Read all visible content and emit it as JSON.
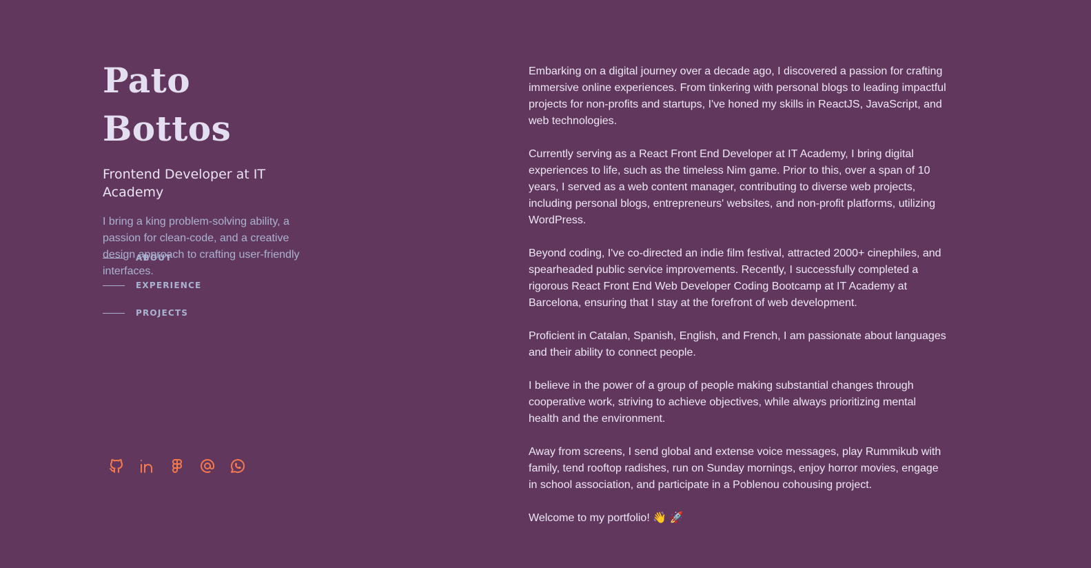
{
  "header": {
    "name": "Pato Bottos",
    "role": "Frontend Developer at IT Academy",
    "tagline": "I bring a king problem-solving ability, a passion for clean-code, and a creative design approach to crafting user-friendly interfaces."
  },
  "nav": {
    "items": [
      {
        "label": "ABOUT"
      },
      {
        "label": "EXPERIENCE"
      },
      {
        "label": "PROJECTS"
      }
    ]
  },
  "socials": [
    {
      "icon": "github-icon"
    },
    {
      "icon": "linkedin-icon"
    },
    {
      "icon": "figma-icon"
    },
    {
      "icon": "email-at-icon"
    },
    {
      "icon": "whatsapp-icon"
    }
  ],
  "about": {
    "paragraphs": [
      "Embarking on a digital journey over a decade ago, I discovered a passion for crafting immersive online experiences. From tinkering with personal blogs to leading impactful projects for non-profits and startups, I've honed my skills in ReactJS, JavaScript, and web technologies.",
      "Currently serving as a React Front End Developer at IT Academy, I bring digital experiences to life, such as the timeless Nim game. Prior to this, over a span of 10 years, I served as a web content manager, contributing to diverse web projects, including personal blogs, entrepreneurs' websites, and non-profit platforms, utilizing WordPress.",
      "Beyond coding, I've co-directed an indie film festival, attracted 2000+ cinephiles, and spearheaded public service improvements. Recently, I successfully completed a rigorous React Front End Web Developer Coding Bootcamp at IT Academy at Barcelona, ensuring that I stay at the forefront of web development.",
      "Proficient in Catalan, Spanish, English, and French, I am passionate about languages and their ability to connect people.",
      "I believe in the power of a group of people making substantial changes through cooperative work, striving to achieve objectives, while always prioritizing mental health and the environment.",
      "Away from screens, I send global and extense voice messages, play Rummikub with family, tend rooftop radishes, run on Sunday mornings, enjoy horror movies, engage in school association, and participate in a Poblenou cohousing project.",
      "Welcome to my portfolio! 👋 🚀"
    ]
  },
  "colors": {
    "background": "#62375d",
    "accent": "#f47a4e",
    "muted": "#a9b3d1",
    "text": "#ece8f4"
  }
}
